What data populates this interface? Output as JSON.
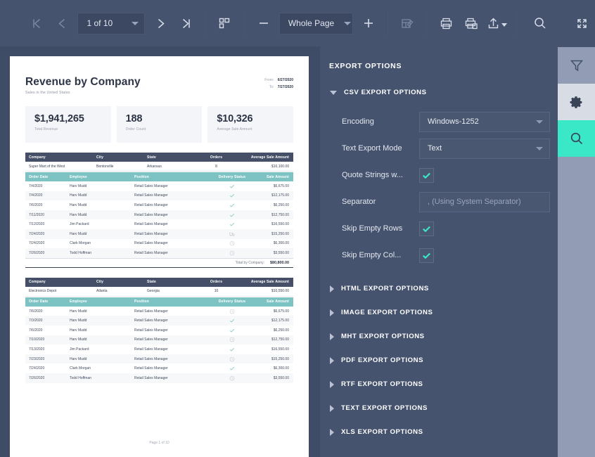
{
  "toolbar": {
    "first_page_label": "First Page",
    "prev_page_label": "Previous Page",
    "page_value": "1 of 10",
    "next_page_label": "Next Page",
    "last_page_label": "Last Page",
    "multipage_label": "Multiple Pages",
    "zoom_out_label": "Zoom Out",
    "zoom_value": "Whole Page",
    "zoom_in_label": "Zoom In",
    "edit_label": "Edit Document",
    "print_label": "Print",
    "print_page_label": "Print Current Page",
    "export_label": "Export To",
    "search_label": "Search",
    "fullscreen_label": "Full Screen"
  },
  "document": {
    "title": "Revenue by Company",
    "subtitle": "Sales in the United States",
    "date_from_label": "From:",
    "date_from_value": "6/27/2020",
    "date_to_label": "To:",
    "date_to_value": "7/27/2020",
    "kpis": [
      {
        "value": "$1,941,265",
        "label": "Total Revenue"
      },
      {
        "value": "188",
        "label": "Order Count"
      },
      {
        "value": "$10,326",
        "label": "Average Sale Amount"
      }
    ],
    "group_columns": [
      "Company",
      "City",
      "State",
      "Orders",
      "Average Sale Amount"
    ],
    "detail_columns": [
      "Order Date",
      "Employee",
      "Position",
      "Delivery Status",
      "Sale Amount"
    ],
    "groups": [
      {
        "company": "Super Mart of the West",
        "city": "Bentonville",
        "state": "Arkansas",
        "orders": "8",
        "average": "$10,100.00",
        "total_label": "Total by Company:",
        "total_value": "$80,800.00",
        "rows": [
          {
            "date": "7/4/2020",
            "employee": "Harv Mudd",
            "position": "Retail Sales Manager",
            "status": "check",
            "amount": "$6,675.00"
          },
          {
            "date": "7/4/2020",
            "employee": "Harv Mudd",
            "position": "Retail Sales Manager",
            "status": "check",
            "amount": "$12,175.00"
          },
          {
            "date": "7/6/2020",
            "employee": "Harv Mudd",
            "position": "Retail Sales Manager",
            "status": "check",
            "amount": "$6,250.00"
          },
          {
            "date": "7/11/2020",
            "employee": "Harv Mudd",
            "position": "Retail Sales Manager",
            "status": "check",
            "amount": "$12,750.00"
          },
          {
            "date": "7/12/2020",
            "employee": "Jim Packard",
            "position": "Retail Sales Manager",
            "status": "check",
            "amount": "$16,550.00"
          },
          {
            "date": "7/24/2020",
            "employee": "Harv Mudd",
            "position": "Retail Sales Manager",
            "status": "truck",
            "amount": "$15,250.00"
          },
          {
            "date": "7/24/2020",
            "employee": "Clark Morgan",
            "position": "Retail Sales Manager",
            "status": "clock",
            "amount": "$6,300.00"
          },
          {
            "date": "7/26/2020",
            "employee": "Todd Hoffman",
            "position": "Retail Sales Manager",
            "status": "clock",
            "amount": "$3,550.00"
          }
        ]
      },
      {
        "company": "Electronics Depot",
        "city": "Atlanta",
        "state": "Georgia",
        "orders": "10",
        "average": "$10,550.00",
        "rows": [
          {
            "date": "7/6/2020",
            "employee": "Harv Mudd",
            "position": "Retail Sales Manager",
            "status": "clock",
            "amount": "$6,675.00"
          },
          {
            "date": "7/3/2020",
            "employee": "Harv Mudd",
            "position": "Retail Sales Manager",
            "status": "check",
            "amount": "$12,175.00"
          },
          {
            "date": "7/6/2020",
            "employee": "Harv Mudd",
            "position": "Retail Sales Manager",
            "status": "check",
            "amount": "$6,250.00"
          },
          {
            "date": "7/10/2020",
            "employee": "Harv Mudd",
            "position": "Retail Sales Manager",
            "status": "clock",
            "amount": "$12,750.00"
          },
          {
            "date": "7/13/2020",
            "employee": "Jim Packard",
            "position": "Retail Sales Manager",
            "status": "check",
            "amount": "$16,550.00"
          },
          {
            "date": "7/23/2020",
            "employee": "Harv Mudd",
            "position": "Retail Sales Manager",
            "status": "clock",
            "amount": "$15,250.00"
          },
          {
            "date": "7/24/2020",
            "employee": "Clark Morgan",
            "position": "Retail Sales Manager",
            "status": "check",
            "amount": "$6,300.00"
          },
          {
            "date": "7/26/2020",
            "employee": "Todd Hoffman",
            "position": "Retail Sales Manager",
            "status": "clock",
            "amount": "$3,550.00"
          }
        ]
      }
    ],
    "footer": "Page 1 of 10"
  },
  "panel": {
    "title": "EXPORT OPTIONS",
    "csv": {
      "label": "CSV EXPORT OPTIONS",
      "expanded": true,
      "encoding_label": "Encoding",
      "encoding_value": "Windows-1252",
      "text_export_mode_label": "Text Export Mode",
      "text_export_mode_value": "Text",
      "quote_strings_label": "Quote Strings w...",
      "quote_strings_checked": true,
      "separator_label": "Separator",
      "separator_placeholder": ", (Using System Separator)",
      "separator_value": "",
      "skip_empty_rows_label": "Skip Empty Rows",
      "skip_empty_rows_checked": true,
      "skip_empty_cols_label": "Skip Empty Col...",
      "skip_empty_cols_checked": true
    },
    "collapsed_sections": [
      "HTML EXPORT OPTIONS",
      "IMAGE EXPORT OPTIONS",
      "MHT EXPORT OPTIONS",
      "PDF EXPORT OPTIONS",
      "RTF EXPORT OPTIONS",
      "TEXT EXPORT OPTIONS",
      "XLS EXPORT OPTIONS"
    ]
  },
  "rail": {
    "filter_label": "Filter",
    "settings_label": "Export Options",
    "search_label": "Search"
  },
  "colors": {
    "accent_teal": "#3ae8c8",
    "toolbar_bg": "#46536e",
    "preview_bg": "#3f4c66",
    "table_header": "#454f68",
    "table_subheader": "#7ec3c4"
  }
}
